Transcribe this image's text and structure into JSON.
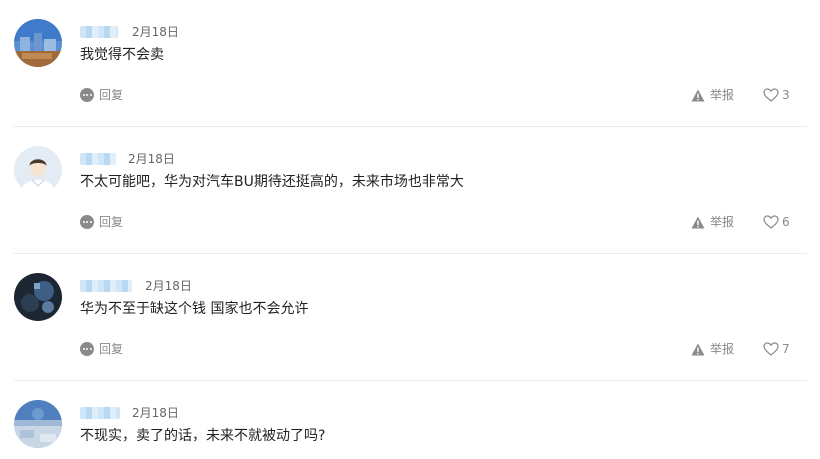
{
  "comments": [
    {
      "date": "2月18日",
      "text": "我觉得不会卖",
      "reply_label": "回复",
      "report_label": "举报",
      "like_count": "3"
    },
    {
      "date": "2月18日",
      "text": "不太可能吧，华为对汽车BU期待还挺高的，未来市场也非常大",
      "reply_label": "回复",
      "report_label": "举报",
      "like_count": "6"
    },
    {
      "date": "2月18日",
      "text": "华为不至于缺这个钱 国家也不会允许",
      "reply_label": "回复",
      "report_label": "举报",
      "like_count": "7"
    },
    {
      "date": "2月18日",
      "text": "不现实，卖了的话，未来不就被动了吗?"
    }
  ],
  "icons": {
    "reply": "comment-bubble-icon",
    "report": "warning-triangle-icon",
    "like": "heart-outline-icon"
  },
  "colors": {
    "text": "#222222",
    "meta": "#666666",
    "action": "#888888",
    "divider": "#ececec",
    "username_blur": "#cfe6f8"
  }
}
